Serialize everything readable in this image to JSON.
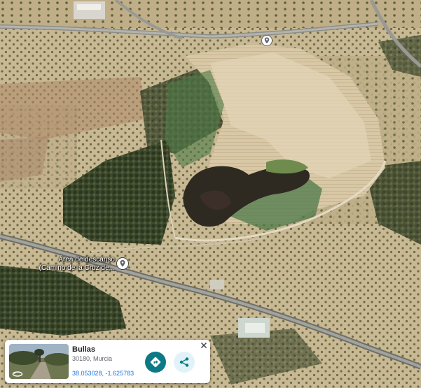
{
  "map": {
    "view": "satellite"
  },
  "poi": {
    "label_line1": "Área de descanso",
    "label_line2": "(Camino de la Cruz de...",
    "icon": "map-pin-icon"
  },
  "top_pin": {
    "icon": "map-pin-icon"
  },
  "info_card": {
    "place_name": "Bullas",
    "address": "30180, Murcia",
    "coordinates": "38.053028, -1.625783",
    "directions_icon": "directions-icon",
    "share_icon": "share-icon",
    "close_icon": "close-icon",
    "rotate_icon": "rotate-360-icon",
    "accent_color": "#0b7a86",
    "coords_color": "#1a73e8"
  }
}
